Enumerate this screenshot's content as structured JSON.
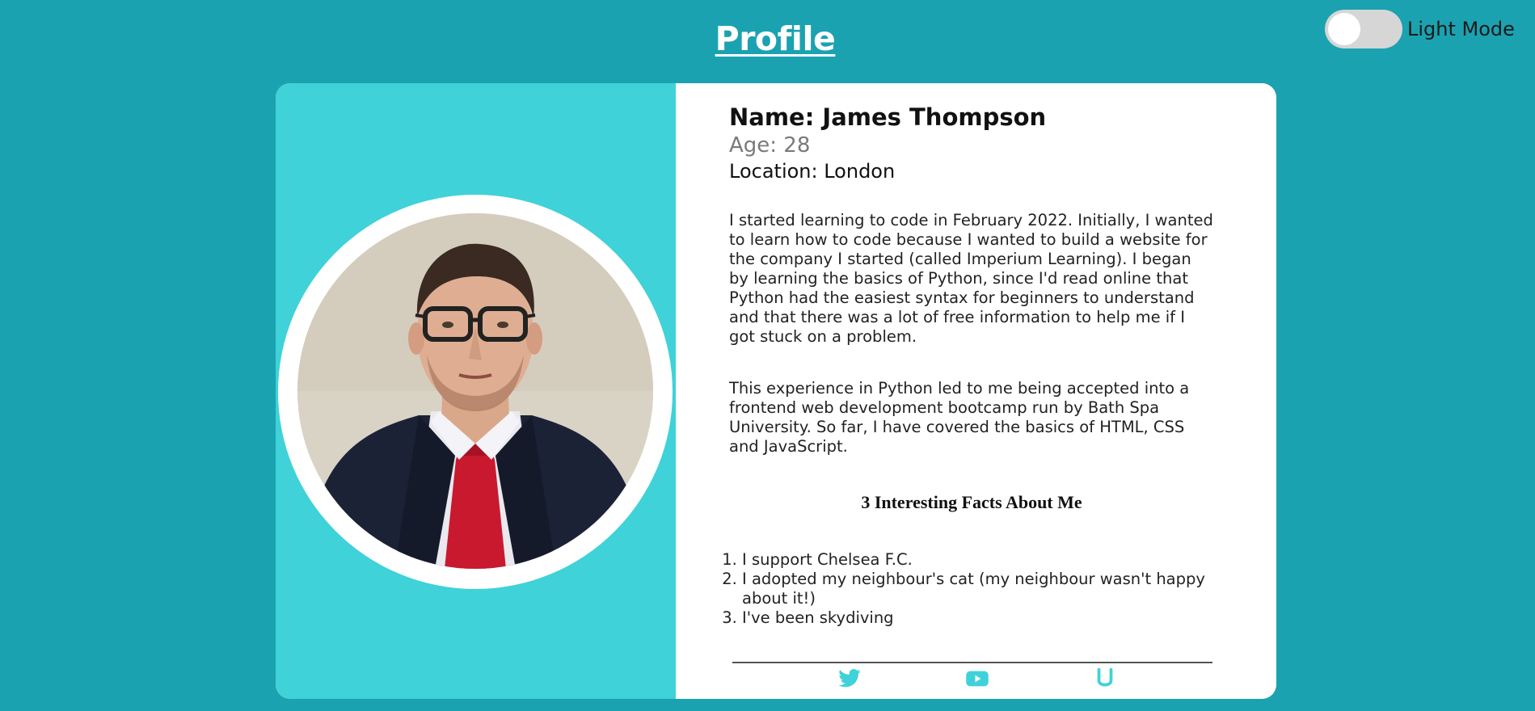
{
  "header": {
    "title": "Profile"
  },
  "mode_toggle": {
    "label": "Light Mode",
    "state": "off"
  },
  "profile": {
    "name": "Name: James Thompson",
    "age": "Age: 28",
    "location": "Location: London",
    "bio_paragraphs": [
      "I started learning to code in February 2022. Initially, I wanted to learn how to code because I wanted to build a website for the company I started (called Imperium Learning). I began by learning the basics of Python, since I'd read online that Python had the easiest syntax for beginners to understand and that there was a lot of free information to help me if I got stuck on a problem.",
      "This experience in Python led to me being accepted into a frontend web development bootcamp run by Bath Spa University. So far, I have covered the basics of HTML, CSS and JavaScript."
    ],
    "facts_heading": "3 Interesting Facts About Me",
    "facts": [
      "I support Chelsea F.C.",
      "I adopted my neighbour's cat (my neighbour wasn't happy about it!)",
      "I've been skydiving"
    ]
  },
  "social": {
    "icons": [
      "twitter-icon",
      "youtube-icon",
      "udemy-icon"
    ]
  },
  "colors": {
    "page_background": "#1ba2b0",
    "card_left": "#3fd2d8",
    "card_right": "#ffffff",
    "accent_icons": "#3fd2d8",
    "toggle_track": "#d6d6d6"
  }
}
